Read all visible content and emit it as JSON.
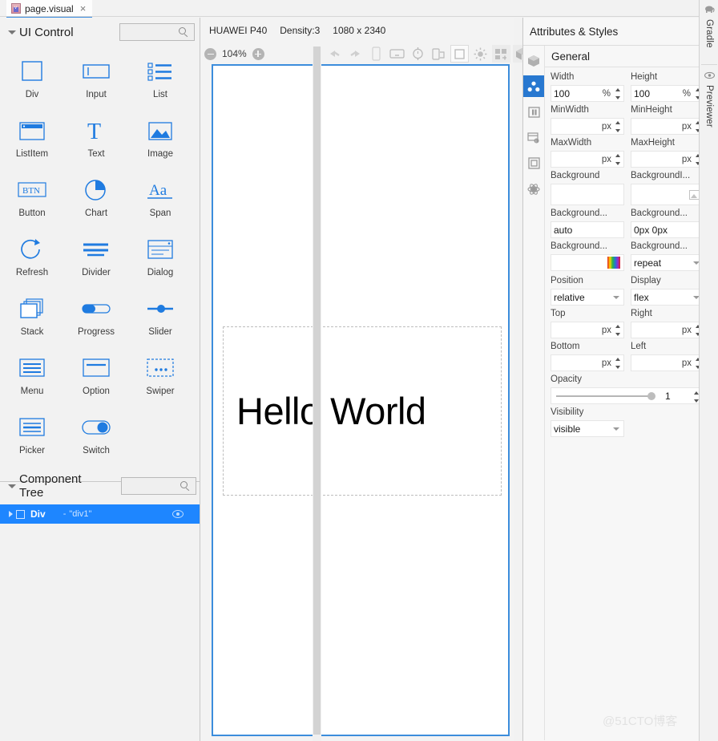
{
  "tab": {
    "title": "page.visual",
    "close": "×",
    "icon": "visual-file-icon"
  },
  "left_panel": {
    "section_title": "UI Control",
    "search_placeholder": "",
    "components": [
      {
        "label": "Div",
        "icon": "div-icon"
      },
      {
        "label": "Input",
        "icon": "input-icon"
      },
      {
        "label": "List",
        "icon": "list-icon"
      },
      {
        "label": "ListItem",
        "icon": "listitem-icon"
      },
      {
        "label": "Text",
        "icon": "text-icon"
      },
      {
        "label": "Image",
        "icon": "image-icon"
      },
      {
        "label": "Button",
        "icon": "button-icon"
      },
      {
        "label": "Chart",
        "icon": "chart-icon"
      },
      {
        "label": "Span",
        "icon": "span-icon"
      },
      {
        "label": "Refresh",
        "icon": "refresh-icon"
      },
      {
        "label": "Divider",
        "icon": "divider-icon"
      },
      {
        "label": "Dialog",
        "icon": "dialog-icon"
      },
      {
        "label": "Stack",
        "icon": "stack-icon"
      },
      {
        "label": "Progress",
        "icon": "progress-icon"
      },
      {
        "label": "Slider",
        "icon": "slider-icon"
      },
      {
        "label": "Menu",
        "icon": "menu-icon"
      },
      {
        "label": "Option",
        "icon": "option-icon"
      },
      {
        "label": "Swiper",
        "icon": "swiper-icon"
      },
      {
        "label": "Picker",
        "icon": "picker-icon"
      },
      {
        "label": "Switch",
        "icon": "switch-icon"
      }
    ],
    "component_tree": {
      "title": "Component Tree",
      "search_placeholder": "",
      "rows": [
        {
          "name": "Div",
          "dash": "-",
          "value": "\"div1\"",
          "selected": true
        }
      ]
    }
  },
  "center": {
    "device": {
      "name": "HUAWEI P40",
      "density": "Density:3",
      "resolution": "1080 x 2340"
    },
    "zoom": {
      "out_label": "−",
      "value": "104%",
      "in_label": "+"
    },
    "tools": [
      {
        "name": "undo-icon"
      },
      {
        "name": "redo-icon"
      },
      {
        "name": "phone-device-icon"
      },
      {
        "name": "tv-device-icon"
      },
      {
        "name": "watch-device-icon"
      },
      {
        "name": "foldable-device-icon"
      },
      {
        "name": "square-device-icon"
      },
      {
        "name": "brightness-icon"
      },
      {
        "name": "layout-direction-icon"
      },
      {
        "name": "cube-3d-icon"
      }
    ],
    "canvas": {
      "text": "Hello World"
    }
  },
  "right_panel": {
    "title": "Attributes & Styles",
    "rail": [
      {
        "name": "cube-icon",
        "active": false
      },
      {
        "name": "attributes-icon",
        "active": true
      },
      {
        "name": "layout-icon",
        "active": false
      },
      {
        "name": "events-icon",
        "active": false
      },
      {
        "name": "box-model-icon",
        "active": false
      },
      {
        "name": "animation-icon",
        "active": false
      }
    ],
    "section": "General",
    "fields": [
      {
        "label": "Width",
        "value": "100",
        "unit": "%",
        "control": "spinner"
      },
      {
        "label": "Height",
        "value": "100",
        "unit": "%",
        "control": "spinner"
      },
      {
        "label": "MinWidth",
        "value": "",
        "unit": "px",
        "control": "spinner"
      },
      {
        "label": "MinHeight",
        "value": "",
        "unit": "px",
        "control": "spinner"
      },
      {
        "label": "MaxWidth",
        "value": "",
        "unit": "px",
        "control": "spinner"
      },
      {
        "label": "MaxHeight",
        "value": "",
        "unit": "px",
        "control": "spinner"
      },
      {
        "label": "Background",
        "value": "",
        "unit": "",
        "control": "plain"
      },
      {
        "label": "BackgroundI...",
        "value": "",
        "unit": "",
        "control": "image"
      },
      {
        "label": "Background...",
        "value": "auto",
        "unit": "",
        "control": "plain"
      },
      {
        "label": "Background...",
        "value": "0px 0px",
        "unit": "",
        "control": "plain"
      },
      {
        "label": "Background...",
        "value": "",
        "unit": "",
        "control": "gradient"
      },
      {
        "label": "Background...",
        "value": "repeat",
        "unit": "",
        "control": "select"
      },
      {
        "label": "Position",
        "value": "relative",
        "unit": "",
        "control": "select"
      },
      {
        "label": "Display",
        "value": "flex",
        "unit": "",
        "control": "select"
      },
      {
        "label": "Top",
        "value": "",
        "unit": "px",
        "control": "spinner"
      },
      {
        "label": "Right",
        "value": "",
        "unit": "px",
        "control": "spinner"
      },
      {
        "label": "Bottom",
        "value": "",
        "unit": "px",
        "control": "spinner"
      },
      {
        "label": "Left",
        "value": "",
        "unit": "px",
        "control": "spinner"
      }
    ],
    "opacity": {
      "label": "Opacity",
      "value": "1"
    },
    "visibility": {
      "label": "Visibility",
      "value": "visible"
    }
  },
  "far_right_tabs": [
    {
      "label": "Gradle",
      "icon": "gradle-elephant-icon"
    },
    {
      "label": "Previewer",
      "icon": "eye-icon"
    }
  ],
  "watermark": "@51CTO博客"
}
